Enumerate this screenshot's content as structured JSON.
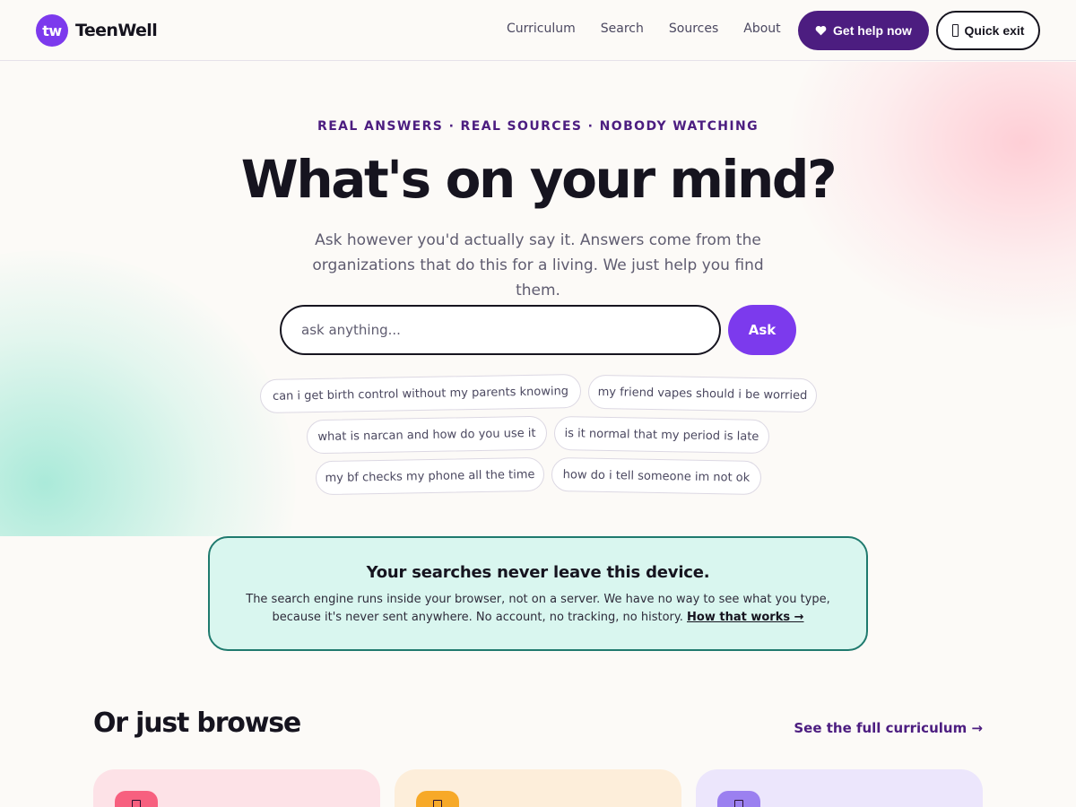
{
  "header": {
    "logo_badge": "tw",
    "logo_text": "TeenWell",
    "nav": [
      "Curriculum",
      "Search",
      "Sources",
      "About"
    ],
    "help_label": "Get help now",
    "exit_label": "Quick exit"
  },
  "hero": {
    "eyebrow": "REAL ANSWERS · REAL SOURCES · NOBODY WATCHING",
    "title": "What's on your mind?",
    "subtitle": "Ask however you'd actually say it. Answers come from the organizations that do this for a living. We just help you find them.",
    "search_placeholder": "ask anything...",
    "ask_label": "Ask",
    "chips": [
      "can i get birth control without my parents knowing",
      "my friend vapes should i be worried",
      "what is narcan and how do you use it",
      "is it normal that my period is late",
      "my bf checks my phone all the time",
      "how do i tell someone im not ok"
    ]
  },
  "privacy": {
    "title": "Your searches never leave this device.",
    "body": "The search engine runs inside your browser, not on a server. We have no way to see what you type, because it's never sent anywhere. No account, no tracking, no history.",
    "link": "How that works →"
  },
  "browse": {
    "title": "Or just browse",
    "link": "See the full curriculum →"
  },
  "colors": {
    "accent": "#7c3aed",
    "accent_dark": "#4c1d80",
    "privacy_bg": "#d9f6ef",
    "privacy_border": "#1f7a6e",
    "card_pink": "#fde2e7",
    "card_peach": "#fdeeda",
    "card_lavender": "#ece6fc"
  },
  "icons": [
    "heart-icon",
    "exit-door-icon",
    "card-icon"
  ]
}
